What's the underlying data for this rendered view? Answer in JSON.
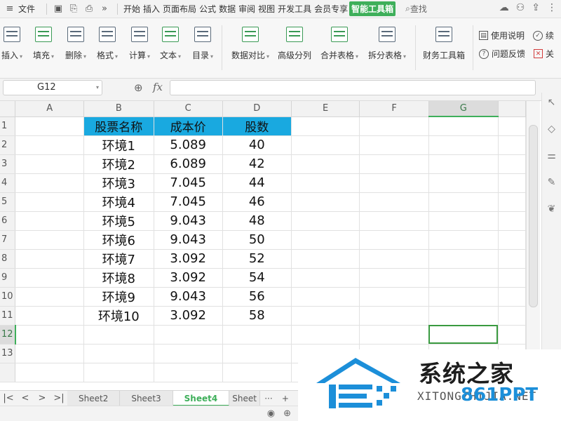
{
  "menubar": {
    "file_label": "文件",
    "tabs": [
      "开始",
      "插入",
      "页面布局",
      "公式",
      "数据",
      "审阅",
      "视图",
      "开发工具",
      "会员专享",
      "智能工具箱"
    ],
    "active_tab": "智能工具箱",
    "search_label": "查找"
  },
  "ribbon": {
    "buttons": [
      {
        "label": "插入",
        "dropdown": true
      },
      {
        "label": "填充",
        "dropdown": true
      },
      {
        "label": "删除",
        "dropdown": true
      },
      {
        "label": "格式",
        "dropdown": true
      },
      {
        "label": "计算",
        "dropdown": true
      },
      {
        "label": "文本",
        "dropdown": true
      },
      {
        "label": "目录",
        "dropdown": true
      },
      {
        "label": "数据对比",
        "dropdown": true
      },
      {
        "label": "高级分列",
        "dropdown": false
      },
      {
        "label": "合并表格",
        "dropdown": true
      },
      {
        "label": "拆分表格",
        "dropdown": true
      },
      {
        "label": "财务工具箱",
        "dropdown": false
      }
    ],
    "side": {
      "help_label": "使用说明",
      "continue_label": "续",
      "feedback_label": "问题反馈",
      "close_label": "关"
    }
  },
  "formula_bar": {
    "name_box": "G12",
    "fx_label": "fx",
    "formula": ""
  },
  "grid": {
    "columns": [
      "A",
      "B",
      "C",
      "D",
      "E",
      "F",
      "G"
    ],
    "selected_column": "G",
    "rows": [
      "1",
      "2",
      "3",
      "4",
      "5",
      "6",
      "7",
      "8",
      "9",
      "10",
      "11",
      "12",
      "13"
    ],
    "selected_row": "12",
    "header_fill": "#19a9e0",
    "table_headers": [
      "股票名称",
      "成本价",
      "股数"
    ],
    "table_rows": [
      [
        "环境1",
        "5.089",
        "40"
      ],
      [
        "环境2",
        "6.089",
        "42"
      ],
      [
        "环境3",
        "7.045",
        "44"
      ],
      [
        "环境4",
        "7.045",
        "46"
      ],
      [
        "环境5",
        "9.043",
        "48"
      ],
      [
        "环境6",
        "9.043",
        "50"
      ],
      [
        "环境7",
        "3.092",
        "52"
      ],
      [
        "环境8",
        "3.092",
        "54"
      ],
      [
        "环境9",
        "9.043",
        "56"
      ],
      [
        "环境10",
        "3.092",
        "58"
      ]
    ]
  },
  "sheets": {
    "tabs": [
      "Sheet2",
      "Sheet3",
      "Sheet4",
      "Sheet"
    ],
    "active": "Sheet4",
    "more_label": "···",
    "add_label": "+"
  },
  "watermark": {
    "title": "系统之家",
    "url": "XITONGZHIJIA.NET",
    "brand": "861PPT"
  },
  "colors": {
    "accent": "#3eaf5a",
    "selection": "#3a9a40"
  }
}
